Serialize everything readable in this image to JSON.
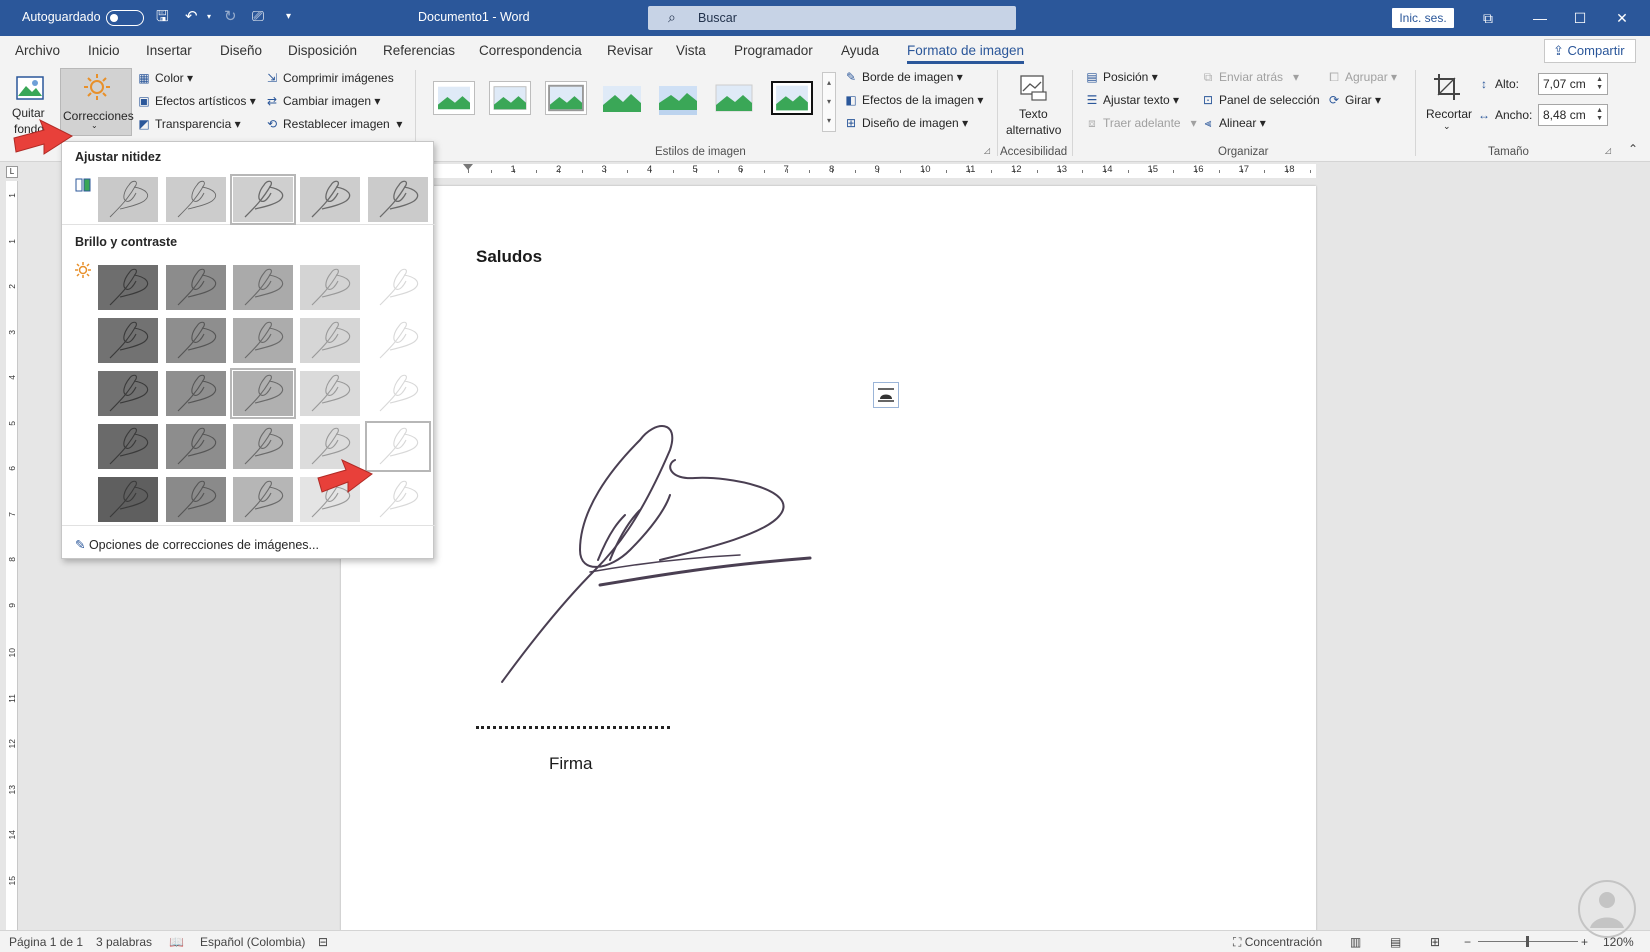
{
  "title_bar": {
    "autosave_label": "Autoguardado",
    "document_title": "Documento1 - Word",
    "search_placeholder": "Buscar",
    "signin_label": "Inic. ses."
  },
  "ribbon_tabs": [
    "Archivo",
    "Inicio",
    "Insertar",
    "Diseño",
    "Disposición",
    "Referencias",
    "Correspondencia",
    "Revisar",
    "Vista",
    "Programador",
    "Ayuda",
    "Formato de imagen"
  ],
  "share_label": "Compartir",
  "ribbon": {
    "remove_bg_label_1": "Quitar",
    "remove_bg_label_2": "fondo",
    "corrections_label": "Correcciones",
    "color_label": "Color",
    "artistic_label": "Efectos artísticos",
    "transparency_label": "Transparencia",
    "compress_label": "Comprimir imágenes",
    "change_label": "Cambiar imagen",
    "reset_label": "Restablecer imagen",
    "styles_group": "Estilos de imagen",
    "border_label": "Borde de imagen",
    "effects_label": "Efectos de la imagen",
    "layout_label": "Diseño de imagen",
    "alt_text_1": "Texto",
    "alt_text_2": "alternativo",
    "accessibility_group": "Accesibilidad",
    "position_label": "Posición",
    "wrap_label": "Ajustar texto",
    "forward_label": "Traer adelante",
    "backward_label": "Enviar atrás",
    "selection_pane_label": "Panel de selección",
    "align_label": "Alinear",
    "group_label": "Agrupar",
    "rotate_label": "Girar",
    "arrange_group": "Organizar",
    "crop_label": "Recortar",
    "height_label": "Alto:",
    "height_value": "7,07 cm",
    "width_label": "Ancho:",
    "width_value": "8,48 cm",
    "size_group": "Tamaño"
  },
  "ruler_numbers": [
    "1",
    "2",
    "3",
    "4",
    "5",
    "6",
    "7",
    "8",
    "9",
    "10",
    "11",
    "12",
    "13",
    "14",
    "15",
    "16",
    "17",
    "18"
  ],
  "vruler_numbers": [
    "1",
    "1",
    "2",
    "3",
    "4",
    "5",
    "6",
    "7",
    "8",
    "9",
    "10",
    "11",
    "12",
    "13",
    "14",
    "15"
  ],
  "dropdown": {
    "sharpen_heading": "Ajustar nitidez",
    "brightness_heading": "Brillo y contraste",
    "options_link": "Opciones de correcciones de imágenes..."
  },
  "document": {
    "heading": "Saludos",
    "signature_caption": "Firma"
  },
  "status_bar": {
    "page": "Página 1 de 1",
    "words": "3 palabras",
    "language": "Español (Colombia)",
    "focus": "Concentración",
    "zoom": "120%"
  },
  "colors": {
    "word_blue": "#2b579a",
    "arrow_red": "#e8403a"
  }
}
